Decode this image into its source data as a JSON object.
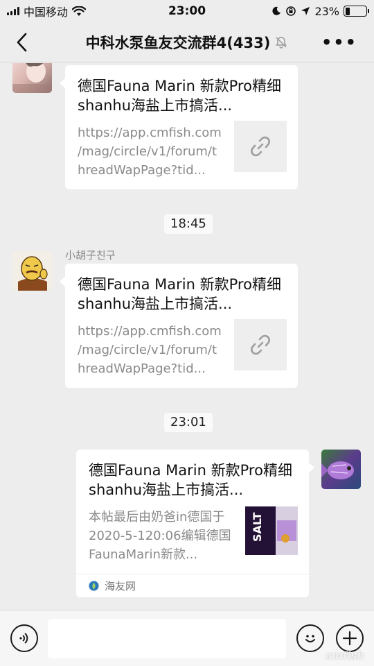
{
  "status_bar": {
    "carrier": "中国移动",
    "time": "23:00",
    "battery": "23%",
    "battery_level": 0.23
  },
  "header": {
    "title": "中科水泵鱼友交流群4(433)",
    "back_icon": "chevron-left-icon",
    "mute_icon": "bell-off-icon",
    "more_icon": "more-dots-icon"
  },
  "messages": [
    {
      "title": "德国Fauna Marin 新款Pro精细shanhu海盐上市搞活...",
      "desc": "https://app.cmfish.com/mag/circle/v1/forum/threadWapPage?tid...",
      "thumb_icon": "link-icon"
    },
    {
      "time": "18:45",
      "sender": "小胡子친구",
      "title": "德国Fauna Marin 新款Pro精细shanhu海盐上市搞活...",
      "desc": "https://app.cmfish.com/mag/circle/v1/forum/threadWapPage?tid...",
      "thumb_icon": "link-icon"
    },
    {
      "time": "23:01",
      "title": "德国Fauna Marin 新款Pro精细shanhu海盐上市搞活...",
      "desc": "本帖最后由奶爸in德国于2020-5-120:06编辑德国FaunaMarin新款...",
      "source": "海友网",
      "thumb_text": "SALT"
    }
  ],
  "input_bar": {
    "voice_icon": "voice-icon",
    "emoji_icon": "emoji-icon",
    "plus_icon": "plus-icon"
  },
  "watermark": "cmfish"
}
